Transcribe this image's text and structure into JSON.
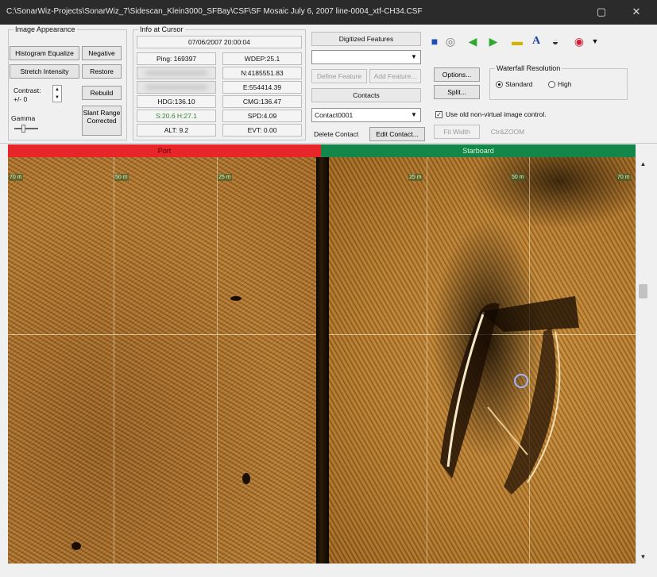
{
  "window": {
    "title": "C:\\SonarWiz-Projects\\SonarWiz_7\\Sidescan_Klein3000_SFBay\\CSF\\SF Mosaic July 6, 2007 line-0004_xtf-CH34.CSF",
    "minimize": "▢",
    "close": "✕"
  },
  "appearance": {
    "title": "Image Appearance",
    "histogram_equalize": "Histogram Equalize",
    "negative": "Negative",
    "stretch_intensity": "Stretch Intensity",
    "restore": "Restore",
    "contrast_label": "Contrast:",
    "contrast_value": "+/- 0",
    "rebuild": "Rebuild",
    "gamma_label": "Gamma",
    "slant_range": "Slant Range Corrected",
    "gamma_level": 0.3
  },
  "cursor_info": {
    "title": "Info at Cursor",
    "datetime": "07/06/2007 20:00:04",
    "ping": "Ping: 169397",
    "wdep": "WDEP:25.1",
    "n": "N:4185551.83",
    "e": "E:554414.39",
    "hdg": "HDG:136.10",
    "cmg": "CMG:136.47",
    "s": "S:20.6 H:27.1",
    "spd": "SPD:4.09",
    "alt": "ALT: 9.2",
    "evt": "EVT: 0.00",
    "s_color": "#2e8b2e"
  },
  "digitized": {
    "title": "Digitized Features",
    "combo_value": "",
    "define_feature": "Define Feature",
    "add_feature": "Add Feature...",
    "contacts_title": "Contacts",
    "contact_value": "Contact0001",
    "delete_contact": "Delete Contact",
    "edit_contact": "Edit Contact..."
  },
  "options": {
    "options_btn": "Options...",
    "split_btn": "Split...",
    "waterfall_title": "Waterfall Resolution",
    "standard": "Standard",
    "high": "High",
    "use_old_control": "Use old non-virtual image control.",
    "fit_width": "Fit Width",
    "ctr_zoom": "Ctr&ZOOM"
  },
  "toolbar_icons": [
    "save-icon",
    "disk-icon",
    "back-arrow-icon",
    "forward-arrow-icon",
    "tape-icon",
    "text-icon",
    "globe-icon",
    "target-icon",
    "dropdown-icon"
  ],
  "colors": {
    "port": "#e8262a",
    "starboard": "#13864a"
  },
  "waterfall": {
    "port_label": "Port",
    "starboard_label": "Starboard",
    "range_labels": [
      "70 m",
      "50 m",
      "25 m",
      "25 m",
      "50 m",
      "70 m"
    ]
  }
}
